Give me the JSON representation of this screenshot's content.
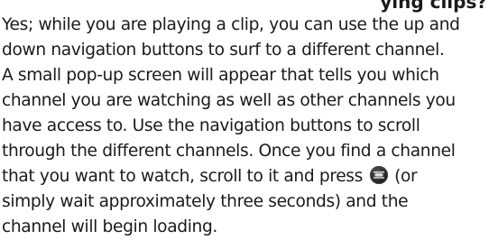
{
  "heading_fragment": "ying clips?",
  "paragraph": {
    "lines": [
      "Yes; while you are playing a clip, you can use the up and",
      "down navigation buttons to surf to a different channel.",
      "A small pop-up screen will appear that tells you which",
      "channel you are watching as well as other channels you",
      "have access to. Use the navigation buttons to scroll",
      "through the different channels. Once you find a channel",
      "that you want to watch, scroll to it and press",
      "simply wait approximately three seconds) and the",
      "channel will begin loading."
    ],
    "line7_after_icon": "(or",
    "icon": "menu-ok-icon"
  }
}
